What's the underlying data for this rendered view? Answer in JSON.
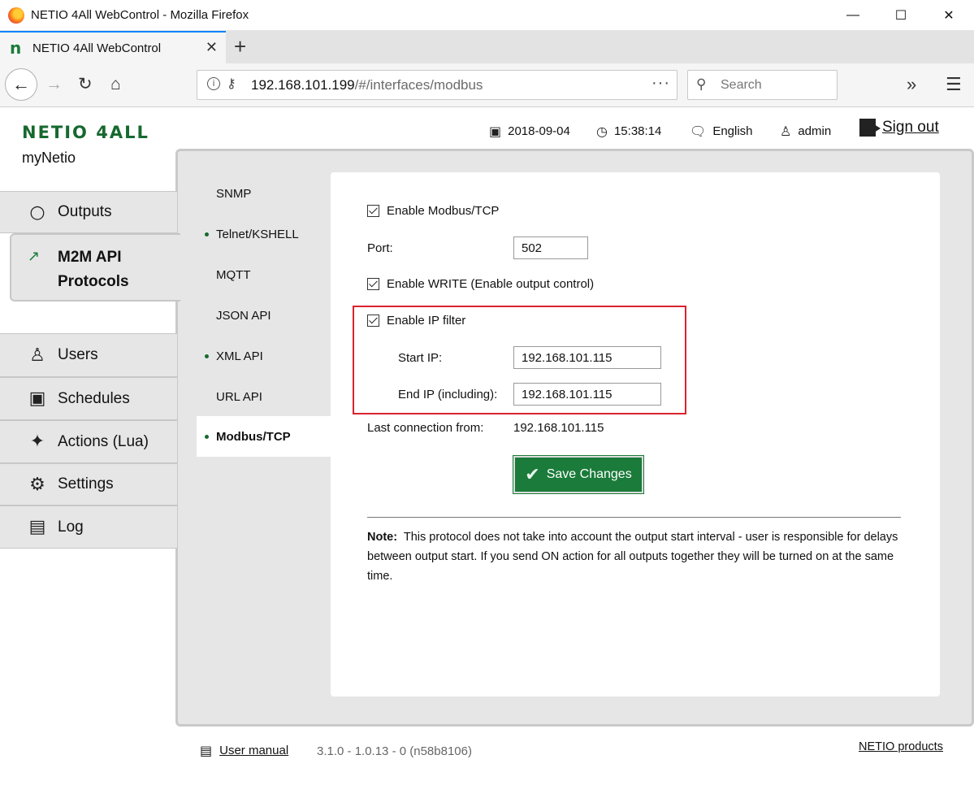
{
  "browser": {
    "window_title": "NETIO 4All WebControl - Mozilla Firefox",
    "tab_title": "NETIO 4All WebControl",
    "url_host": "192.168.101.199",
    "url_path": "/#/interfaces/modbus",
    "search_placeholder": "Search"
  },
  "header": {
    "brand": "NETIO 4ALL",
    "device_name": "myNetio",
    "date": "2018-09-04",
    "time": "15:38:14",
    "language": "English",
    "user": "admin",
    "signout_label": "Sign out"
  },
  "sidebar": {
    "items": [
      {
        "label": "Outputs",
        "icon": "outlet-icon"
      },
      {
        "label": "M2M API Protocols",
        "icon": "m2m-icon",
        "active": true
      },
      {
        "label": "Users",
        "icon": "user-icon"
      },
      {
        "label": "Schedules",
        "icon": "calendar-icon"
      },
      {
        "label": "Actions (Lua)",
        "icon": "magic-wand-icon"
      },
      {
        "label": "Settings",
        "icon": "gear-icon"
      },
      {
        "label": "Log",
        "icon": "document-icon"
      }
    ]
  },
  "subnav": {
    "items": [
      {
        "label": "SNMP",
        "enabled": false
      },
      {
        "label": "Telnet/KSHELL",
        "enabled": true
      },
      {
        "label": "MQTT",
        "enabled": false
      },
      {
        "label": "JSON API",
        "enabled": false
      },
      {
        "label": "XML API",
        "enabled": true
      },
      {
        "label": "URL API",
        "enabled": false
      },
      {
        "label": "Modbus/TCP",
        "enabled": true,
        "active": true
      }
    ]
  },
  "form": {
    "enable_modbus_label": "Enable Modbus/TCP",
    "enable_modbus_checked": true,
    "port_label": "Port:",
    "port_value": "502",
    "enable_write_label": "Enable WRITE (Enable output control)",
    "enable_write_checked": true,
    "enable_ipfilter_label": "Enable IP filter",
    "enable_ipfilter_checked": true,
    "start_ip_label": "Start IP:",
    "start_ip_value": "192.168.101.115",
    "end_ip_label": "End IP (including):",
    "end_ip_value": "192.168.101.115",
    "last_connection_label": "Last connection from:",
    "last_connection_value": "192.168.101.115",
    "save_label": "Save Changes",
    "note_label": "Note:",
    "note_text": "This protocol does not take into account the output start interval - user is responsible for delays between output start. If you send ON action for all outputs together they will be turned on at the same time."
  },
  "footer": {
    "manual_label": "User manual",
    "version": "3.1.0 - 1.0.13 - 0 (n58b8106)",
    "products_label": "NETIO products"
  },
  "colors": {
    "brand_green": "#1b7b3a",
    "highlight_red": "#d9232d",
    "panel_gray": "#e6e6e6"
  }
}
